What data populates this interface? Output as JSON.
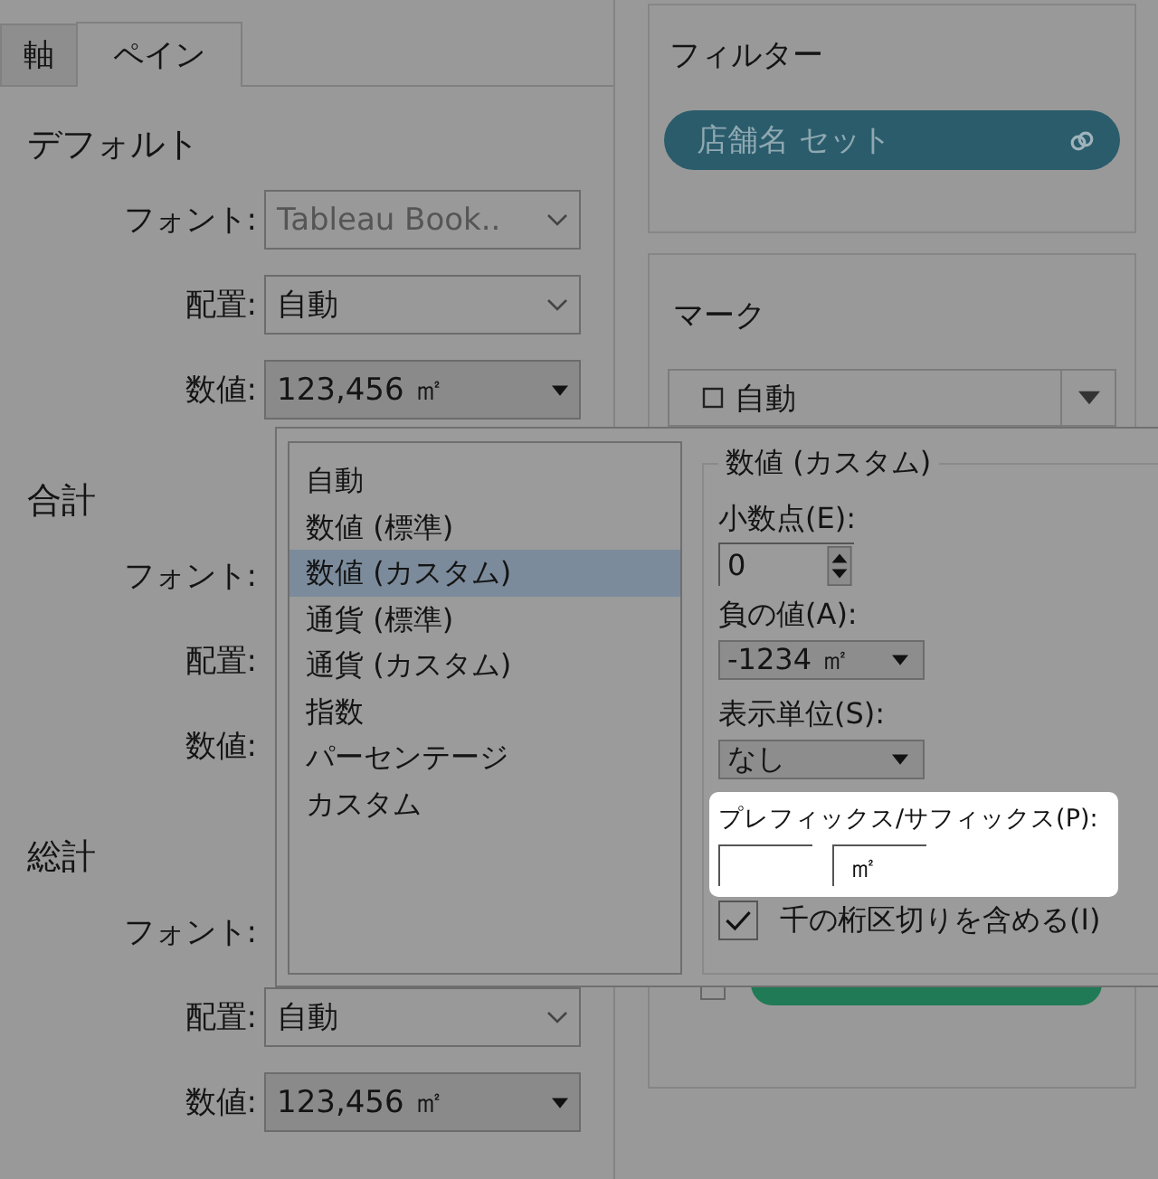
{
  "tabs": [
    {
      "label": "軸",
      "selected": false
    },
    {
      "label": "ペイン",
      "selected": true
    }
  ],
  "sections": [
    {
      "title": "デフォルト",
      "rows": [
        {
          "label": "フォント:",
          "control": {
            "kind": "select",
            "value": "Tableau Book..",
            "disabled": true
          }
        },
        {
          "label": "配置:",
          "control": {
            "kind": "select",
            "value": "自動",
            "disabled": false
          }
        },
        {
          "label": "数値:",
          "control": {
            "kind": "menu",
            "value": "123,456 ㎡",
            "disabled": false
          }
        }
      ]
    },
    {
      "title": "合計",
      "rows": [
        {
          "label": "フォント:"
        },
        {
          "label": "配置:"
        },
        {
          "label": "数値:"
        }
      ]
    },
    {
      "title": "総計",
      "rows": [
        {
          "label": "フォント:"
        },
        {
          "label": "配置:",
          "control": {
            "kind": "select",
            "value": "自動",
            "disabled": false
          }
        },
        {
          "label": "数値:",
          "control": {
            "kind": "menu",
            "value": "123,456 ㎡",
            "disabled": false
          }
        }
      ]
    }
  ],
  "filters": {
    "title": "フィルター",
    "pills": [
      {
        "label": "店舗名 セット",
        "color": "#2a5c6c"
      }
    ]
  },
  "marks": {
    "title": "マーク",
    "type": "自動",
    "pills": [
      {
        "color": "#1f7a55"
      }
    ]
  },
  "format_popup": {
    "list": [
      {
        "label": "自動",
        "selected": false
      },
      {
        "label": "数値 (標準)",
        "selected": false
      },
      {
        "label": "数値 (カスタム)",
        "selected": true
      },
      {
        "label": "通貨 (標準)",
        "selected": false
      },
      {
        "label": "通貨 (カスタム)",
        "selected": false
      },
      {
        "label": "指数",
        "selected": false
      },
      {
        "label": "パーセンテージ",
        "selected": false
      },
      {
        "label": "カスタム",
        "selected": false
      }
    ],
    "group_title": "数値 (カスタム)",
    "decimals": {
      "label": "小数点(E):",
      "value": "0"
    },
    "negative": {
      "label": "負の値(A):",
      "value": "-1234 ㎡"
    },
    "units": {
      "label": "表示単位(S):",
      "value": "なし"
    },
    "affix": {
      "label": "プレフィックス/サフィックス(P):",
      "suffix": "㎡"
    },
    "thousands": {
      "label": "千の桁区切りを含める(I)",
      "checked": true
    }
  }
}
